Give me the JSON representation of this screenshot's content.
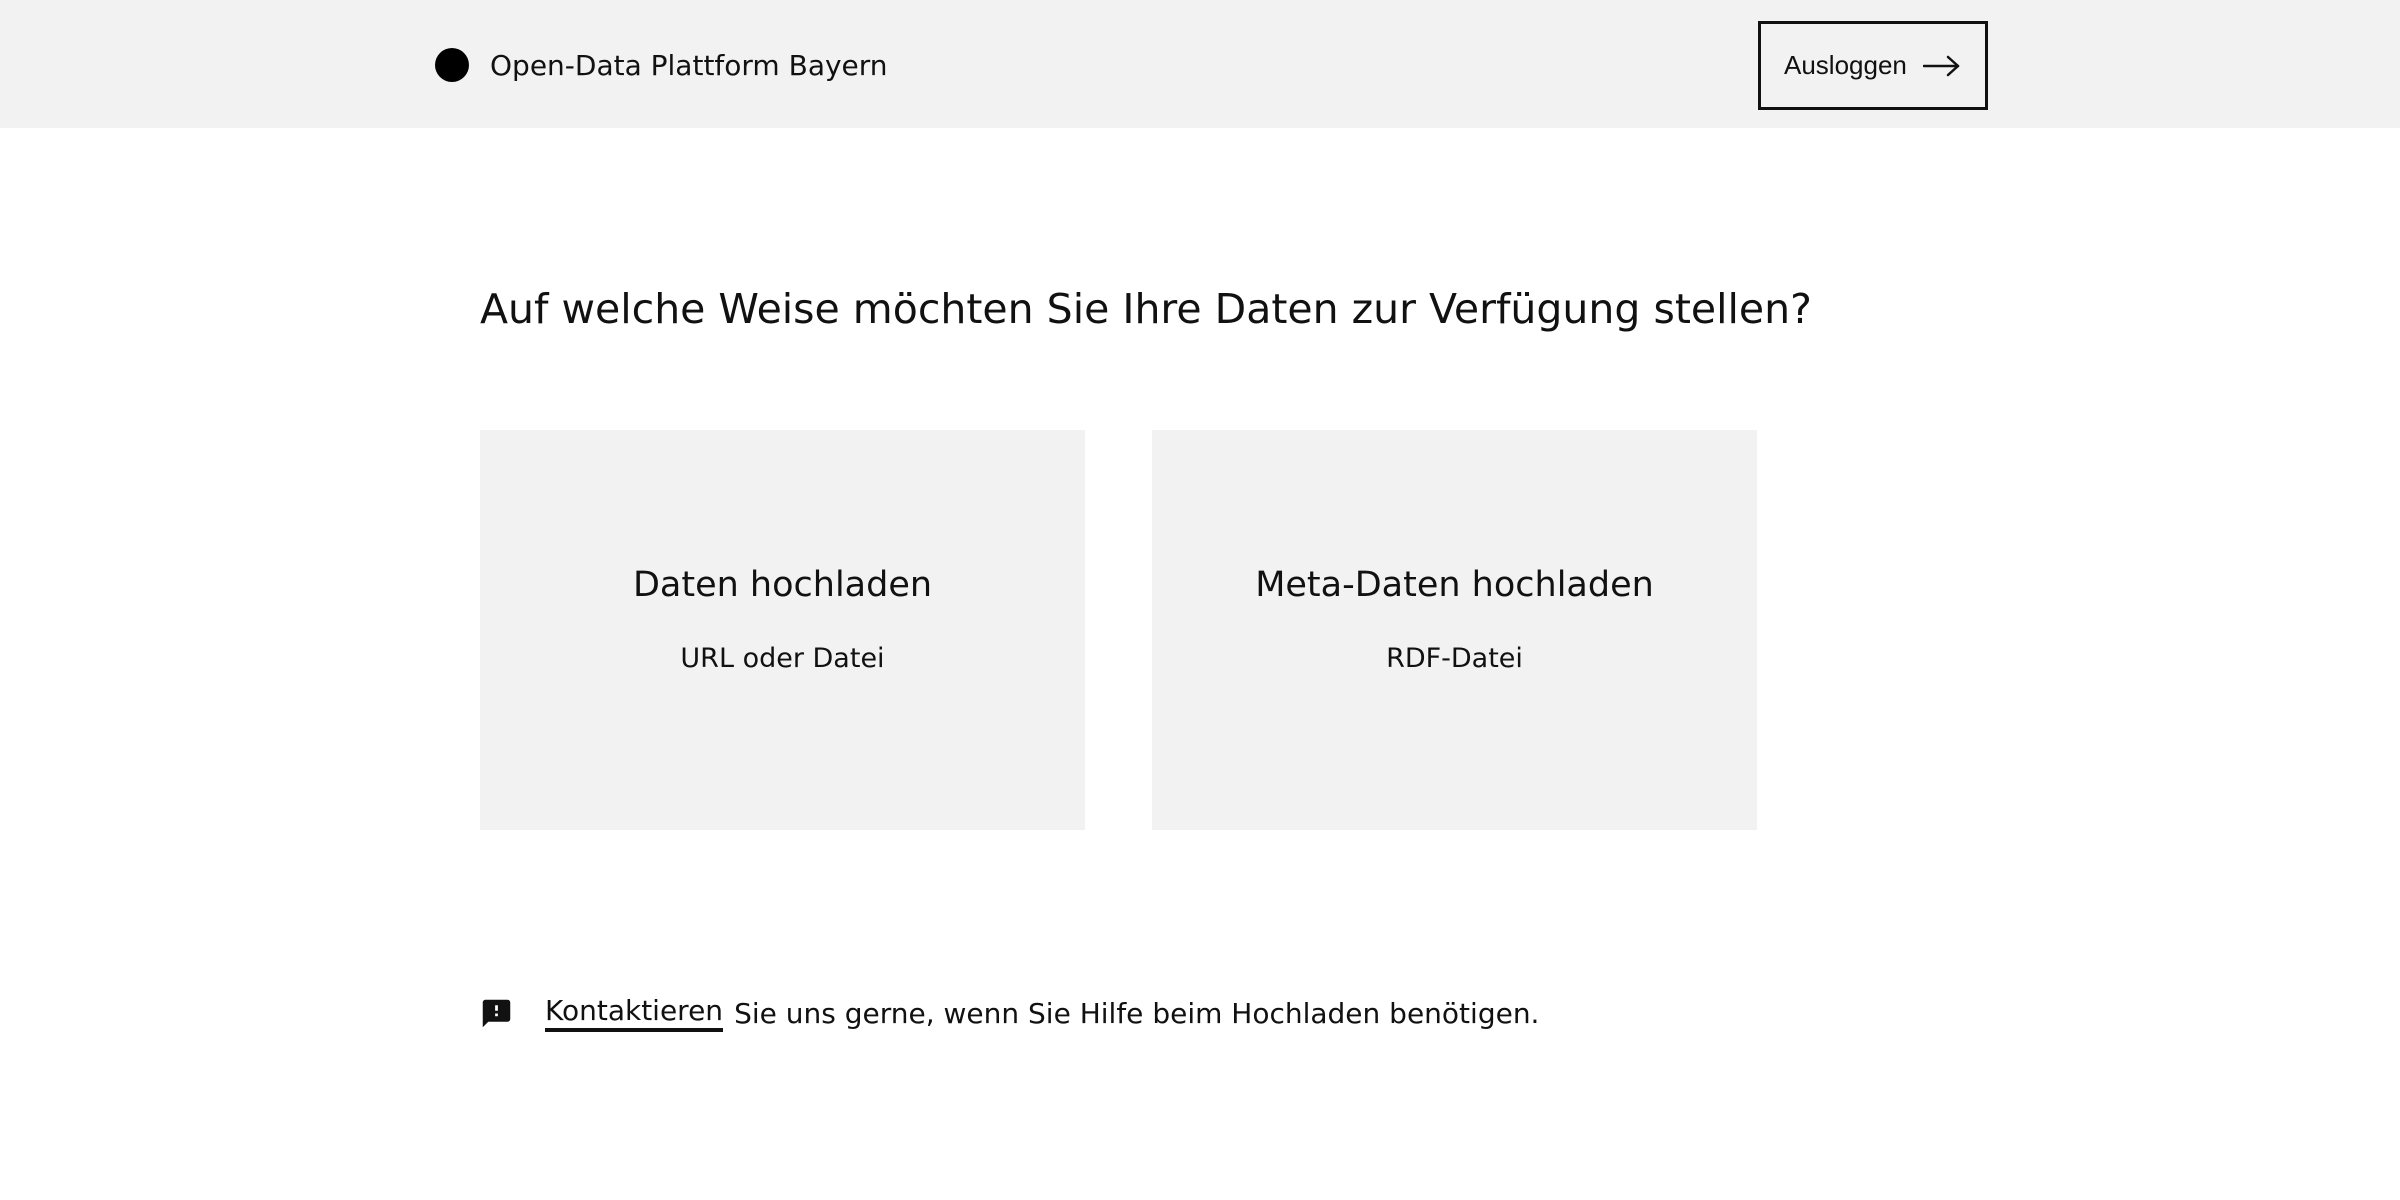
{
  "header": {
    "title": "Open-Data Plattform Bayern",
    "logo_icon": "circle-logo-icon",
    "logout_label": "Ausloggen",
    "logout_icon": "arrow-right-icon"
  },
  "main": {
    "question": "Auf welche Weise möchten Sie Ihre Daten zur Verfügung stellen?",
    "options": [
      {
        "title": "Daten hochladen",
        "subtitle": "URL oder Datei"
      },
      {
        "title": "Meta-Daten hochladen",
        "subtitle": "RDF-Datei"
      }
    ]
  },
  "help": {
    "icon": "feedback-icon",
    "link_label": "Kontaktieren",
    "text": "Sie uns gerne, wenn Sie Hilfe beim Hochladen benötigen."
  },
  "colors": {
    "header_background": "#f2f2f2",
    "card_background": "#f2f2f2",
    "text": "#111111"
  }
}
